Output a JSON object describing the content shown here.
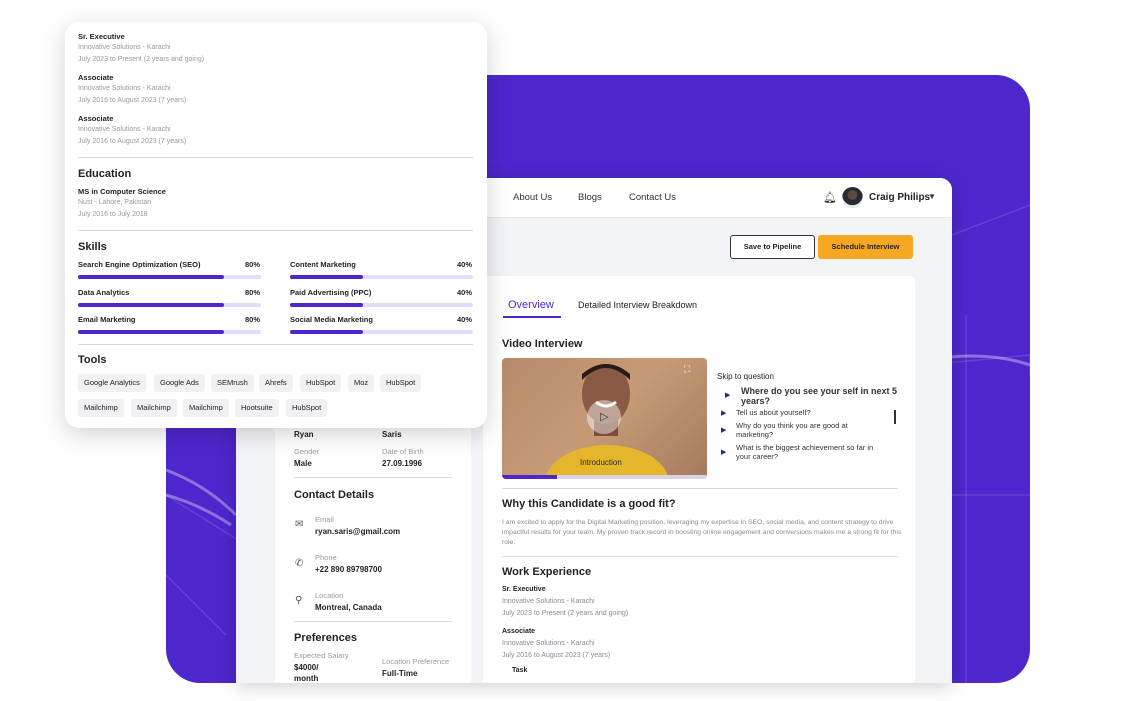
{
  "nav": {
    "links": [
      "About Us",
      "Blogs",
      "Contact Us"
    ],
    "user_name": "Craig Philips"
  },
  "actions": {
    "pipeline": "Save to Pipeline",
    "schedule": "Schedule Interview"
  },
  "profile": {
    "first_name": "Ryan",
    "last_name": "Saris",
    "gender_label": "Gender",
    "gender": "Male",
    "dob_label": "Date of Birth",
    "dob": "27.09.1996"
  },
  "contact": {
    "heading": "Contact Details",
    "email_label": "Email",
    "email": "ryan.saris@gmail.com",
    "phone_label": "Phone",
    "phone": "+22 890 89798700",
    "location_label": "Location",
    "location": "Montreal, Canada"
  },
  "preferences": {
    "heading": "Preferences",
    "salary_label": "Expected Salary",
    "salary": "$4000/",
    "salary_cont": "month",
    "location_label": "Location Preference",
    "location": "Full-Time"
  },
  "tabs": [
    "Overview",
    "Detailed Interview Breakdown"
  ],
  "video": {
    "heading": "Video Interview",
    "caption": "Introduction",
    "progress": 0.27,
    "skip_label": "Skip to question",
    "questions": [
      "Where do you see your self in next 5 years?",
      "Tell us about yourself?",
      "Why do you think you are good at marketing?",
      "What is the biggest achievement so far in your career?"
    ]
  },
  "fit": {
    "heading": "Why this Candidate is a good fit?",
    "text": "I am excited to apply for the Digital Marketing position, leveraging my expertise in SEO, social media, and content strategy to drive impactful results for your team. My proven track record in boosting online engagement and conversions makes me a strong fit for this role."
  },
  "work": {
    "heading": "Work Experience",
    "items": [
      {
        "title": "Sr. Executive",
        "company": "Innovative Solutions - Karachi",
        "dates": "July 2023 to Present (2 years and going)"
      },
      {
        "title": "Associate",
        "company": "Innovative Solutions - Karachi",
        "dates": "July 2016 to August 2023 (7 years)"
      },
      {
        "title": "Associate",
        "company": "Innovative Solutions - Karachi",
        "dates": "July 2016 to August 2023 (7 years)"
      }
    ],
    "task_label": "Task"
  },
  "education": {
    "heading": "Education",
    "degree": "MS in Computer Science",
    "school": "Nust - Lahore, Pakistan",
    "dates": "July 2016 to July 2018"
  },
  "skills": {
    "heading": "Skills",
    "items": [
      {
        "name": "Search Engine Optimization (SEO)",
        "pct": "80%",
        "value": 0.8
      },
      {
        "name": "Content Marketing",
        "pct": "40%",
        "value": 0.4
      },
      {
        "name": "Data Analytics",
        "pct": "80%",
        "value": 0.8
      },
      {
        "name": "Paid Advertising (PPC)",
        "pct": "40%",
        "value": 0.4
      },
      {
        "name": "Email Marketing",
        "pct": "80%",
        "value": 0.8
      },
      {
        "name": "Social Media Marketing",
        "pct": "40%",
        "value": 0.4
      }
    ]
  },
  "tools": {
    "heading": "Tools",
    "items": [
      "Google Analytics",
      "Google Ads",
      "SEMrush",
      "Ahrefs",
      "HubSpot",
      "Moz",
      "HubSpot",
      "Mailchimp",
      "Mailchimp",
      "Mailchimp",
      "Hootsuite",
      "HubSpot"
    ]
  },
  "colors": {
    "brand": "#4d27cd",
    "accent": "#f7a823"
  }
}
